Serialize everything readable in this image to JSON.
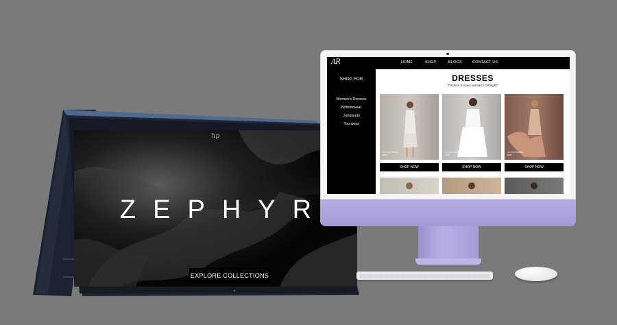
{
  "laptop": {
    "brand_logo": "hp",
    "hero_title": "ZEPHYR",
    "cta_label": "EXPLORE COLLECTIONS"
  },
  "site": {
    "logo": "AR",
    "nav": [
      "HOME",
      "SHOP",
      "BLOGS",
      "CONTACT US"
    ],
    "sidebar": {
      "heading": "SHOP FOR",
      "items": [
        "Women's Dresses",
        "Bottomwear",
        "Jumpsuits",
        "Top wear"
      ]
    },
    "page_title": "DRESSES",
    "page_subtitle": "\"Fashion is every woman's birthright\"",
    "products": [
      {
        "caption": "LA YOKI DRESS\n$560",
        "button": "SHOP NOW",
        "tone": "light"
      },
      {
        "caption": "LA YOKI DRESS\n$560",
        "button": "SHOP NOW",
        "tone": "white"
      },
      {
        "caption": "LA YOKI DRESS\n$560",
        "button": "SHOP NOW",
        "tone": "rose"
      }
    ]
  },
  "colors": {
    "background": "#7a7a7a",
    "imac_accent": "#a59cd6",
    "site_black": "#000000",
    "laptop_body": "#1d2432"
  }
}
